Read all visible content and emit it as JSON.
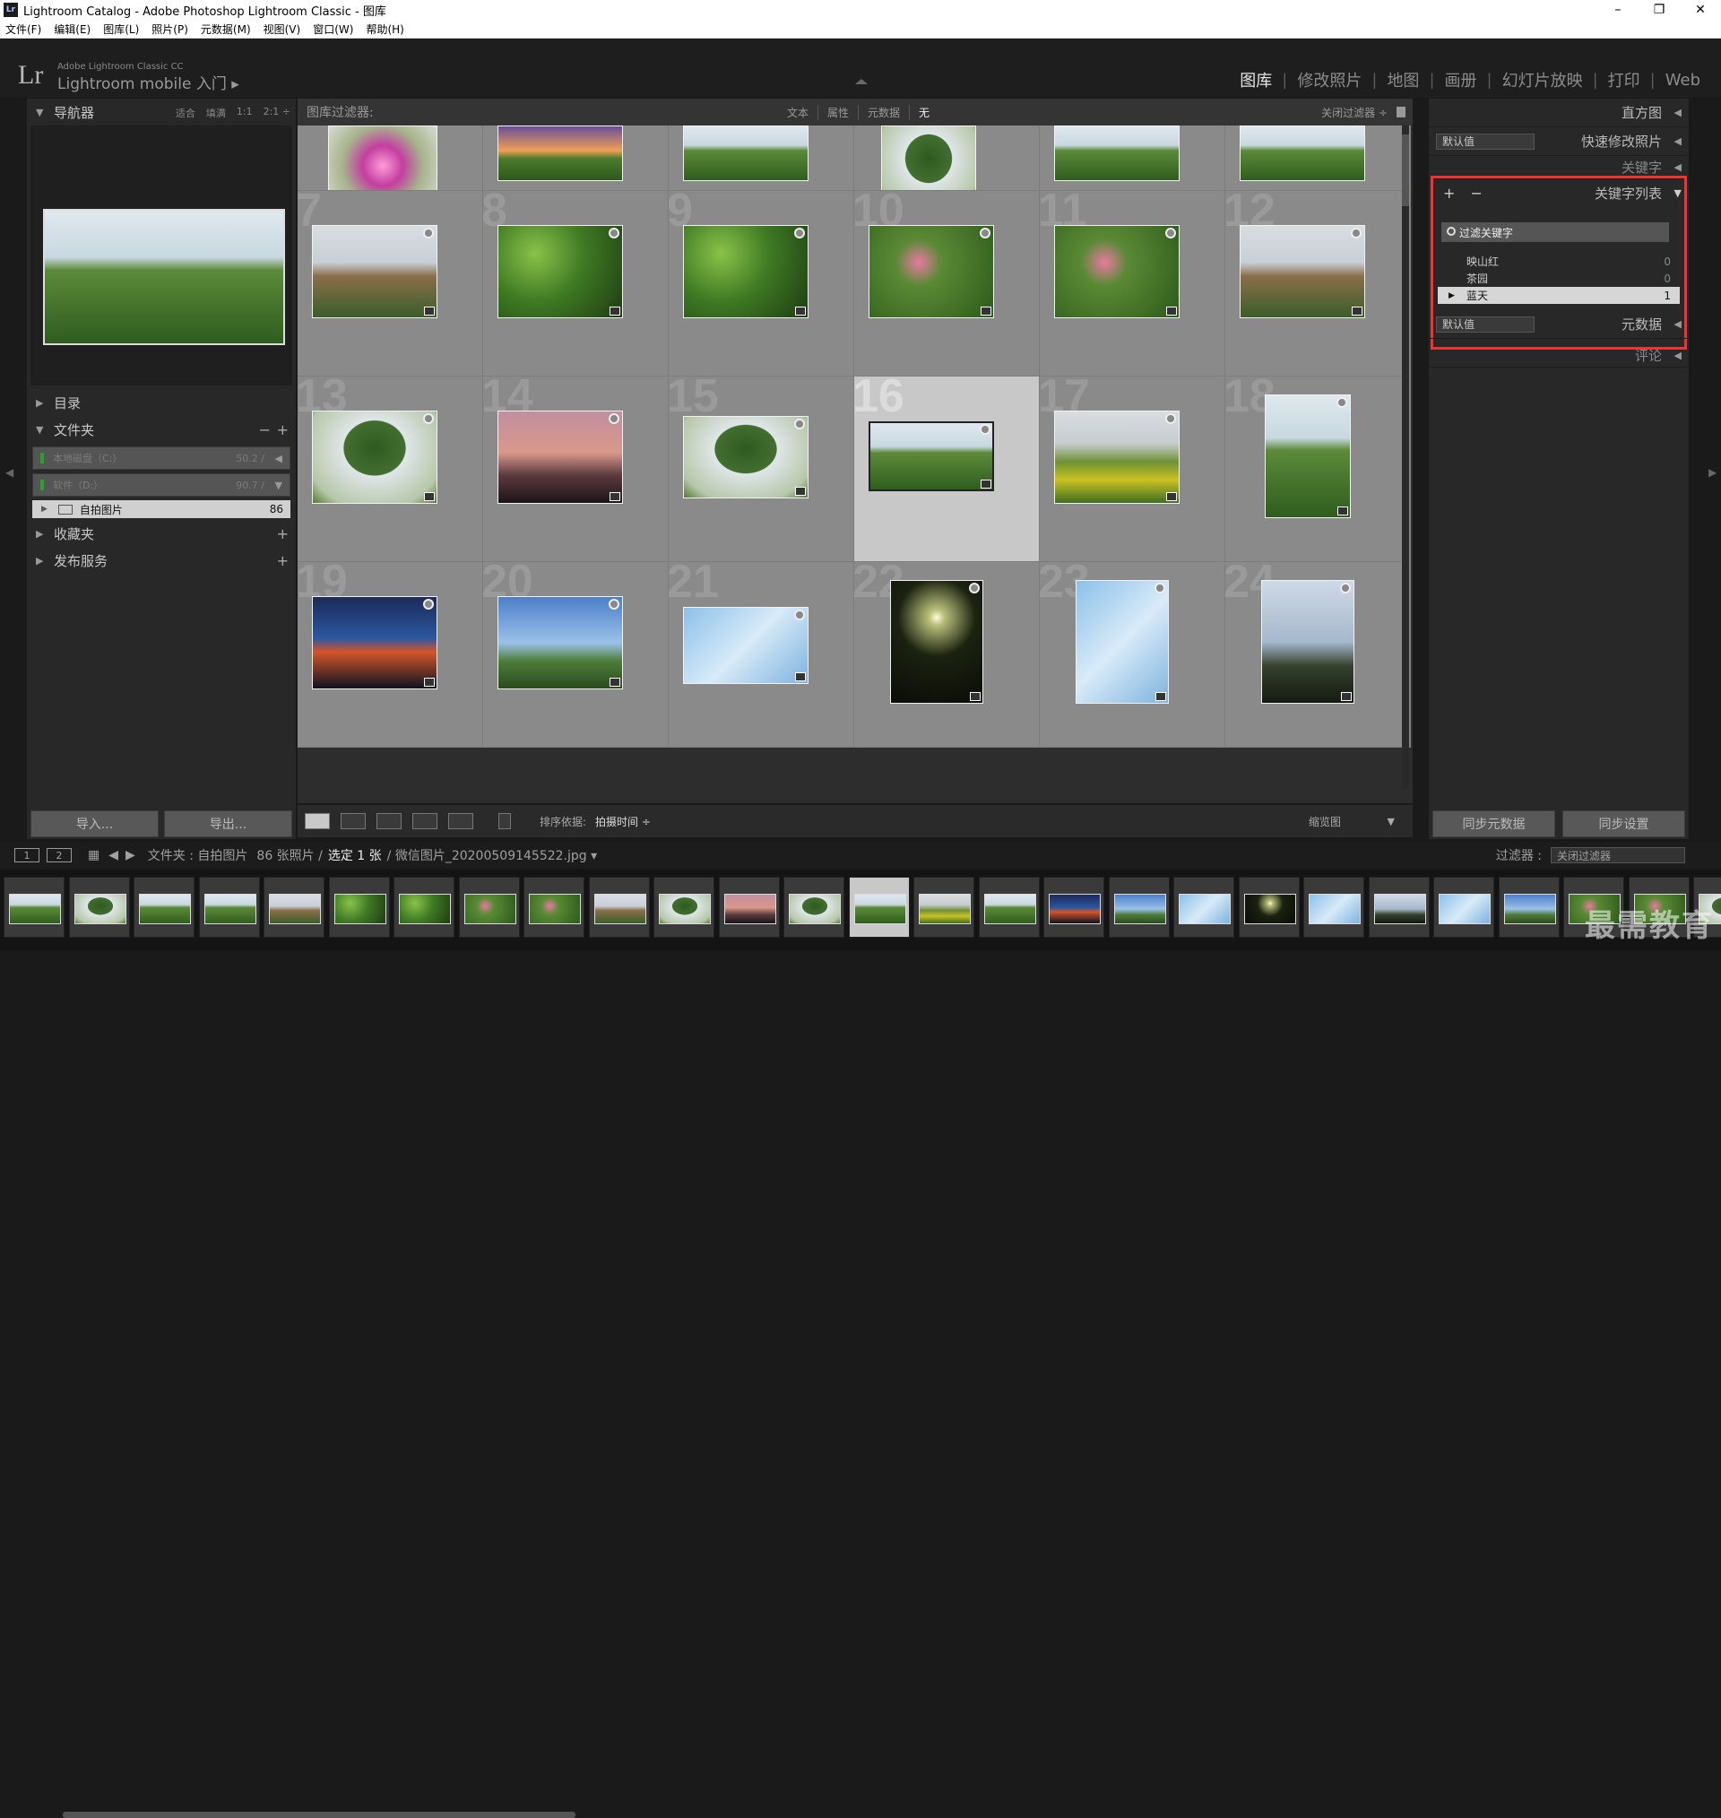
{
  "window": {
    "title": "Lightroom Catalog - Adobe Photoshop Lightroom Classic - 图库",
    "app_icon": "Lr",
    "min": "–",
    "max": "❐",
    "close": "✕"
  },
  "menu": [
    "文件(F)",
    "编辑(E)",
    "图库(L)",
    "照片(P)",
    "元数据(M)",
    "视图(V)",
    "窗口(W)",
    "帮助(H)"
  ],
  "identity": {
    "logo": "Lr",
    "small": "Adobe Lightroom Classic CC",
    "large": "Lightroom mobile 入门 ▸"
  },
  "modules": [
    "图库",
    "修改照片",
    "地图",
    "画册",
    "幻灯片放映",
    "打印",
    "Web"
  ],
  "left": {
    "navigator": "导航器",
    "nav_opts": [
      "适合",
      "填满",
      "1:1",
      "2:1 ÷"
    ],
    "catalog": "目录",
    "folders": "文件夹",
    "folders_minus": "−",
    "folders_plus": "+",
    "vol1": {
      "label": "本地磁盘（C:）",
      "value": "50.2 /"
    },
    "vol2": {
      "label": "软件（D:）",
      "value": "90.7 /"
    },
    "folder": {
      "name": "自拍图片",
      "count": "86"
    },
    "collections": "收藏夹",
    "publish": "发布服务",
    "plus": "+",
    "import": "导入...",
    "export": "导出..."
  },
  "filter": {
    "label": "图库过滤器:",
    "opts": [
      "文本",
      "属性",
      "元数据",
      "无"
    ],
    "close": "关闭过滤器 ÷"
  },
  "cell_numbers": [
    "7",
    "8",
    "9",
    "10",
    "11",
    "12",
    "13",
    "14",
    "15",
    "16",
    "17",
    "18",
    "19",
    "20",
    "21",
    "22",
    "23",
    "24"
  ],
  "toolbar": {
    "sort_label": "排序依据:",
    "sort_value": "拍摄时间 ÷",
    "zoom": "缩览图"
  },
  "right": {
    "histogram": "直方图",
    "quick_develop": "快速修改照片",
    "preset1": "默认值",
    "keywording": "关键字",
    "keyword_list": "关键字列表",
    "plusminus": "+ −",
    "filter_placeholder": "过滤关键字",
    "keywords": [
      {
        "name": "映山红",
        "count": "0"
      },
      {
        "name": "茶园",
        "count": "0"
      },
      {
        "name": "蓝天",
        "count": "1"
      }
    ],
    "preset2": "默认值",
    "metadata": "元数据",
    "comments": "评论",
    "sync_meta": "同步元数据",
    "sync_settings": "同步设置"
  },
  "filmhdr": {
    "p1": "1",
    "p2": "2",
    "path": "文件夹 : 自拍图片",
    "count": "86 张照片 /",
    "selected": "选定 1 张",
    "file": "/ 微信图片_20200509145522.jpg ▾",
    "filter_label": "过滤器 :",
    "filter_value": "关闭过滤器"
  },
  "watermark": "最需教育"
}
